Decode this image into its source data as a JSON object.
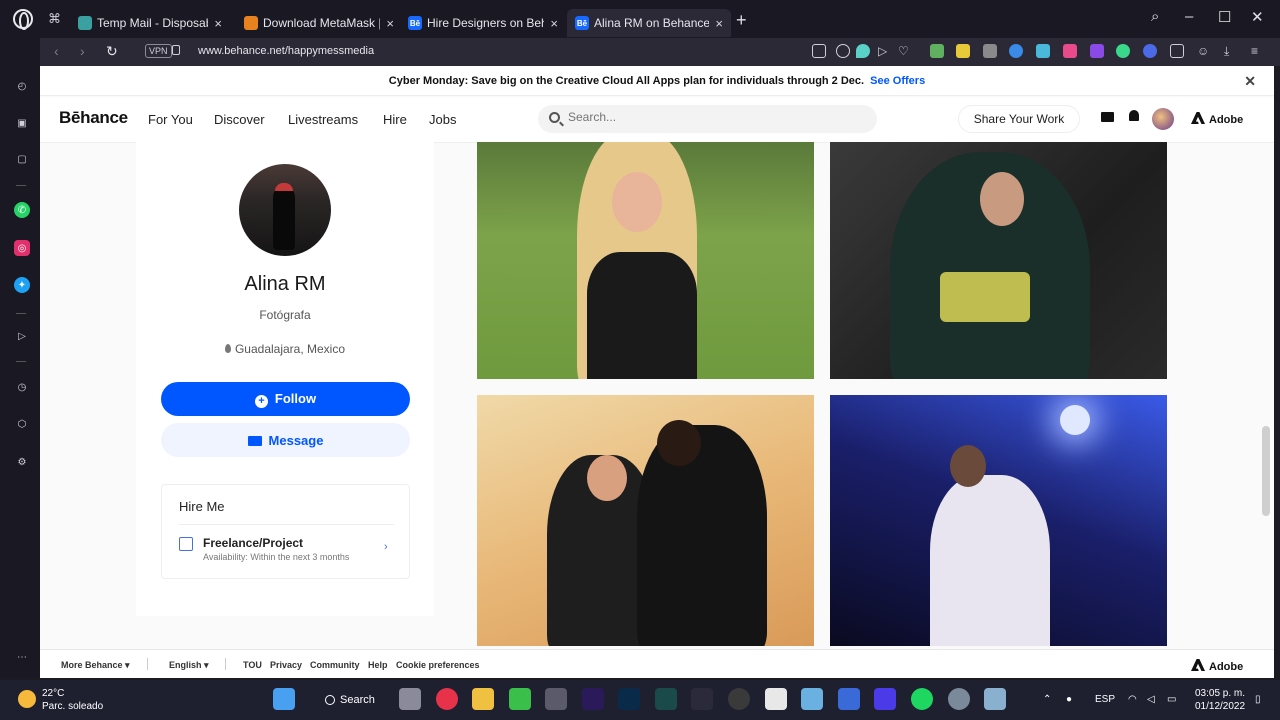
{
  "browser": {
    "tabs": [
      {
        "title": "Temp Mail - Disposable Ter",
        "color": "#3aa0a0",
        "fav": ""
      },
      {
        "title": "Download MetaMask | Bloc",
        "color": "#e8821e",
        "fav": ""
      },
      {
        "title": "Hire Designers on Behance",
        "color": "#1769ff",
        "fav": "Bē"
      },
      {
        "title": "Alina RM on Behance",
        "color": "#1769ff",
        "fav": "Bē"
      }
    ],
    "url": "www.behance.net/happymessmedia",
    "vpn": "VPN"
  },
  "promo": {
    "text": "Cyber Monday: Save big on the Creative Cloud All Apps plan for individuals through 2 Dec.",
    "link": "See Offers"
  },
  "nav": {
    "logo": "Bēhance",
    "links": [
      "For You",
      "Discover",
      "Livestreams",
      "Hire",
      "Jobs"
    ],
    "search_placeholder": "Search...",
    "share": "Share Your Work",
    "adobe": "Adobe"
  },
  "profile": {
    "name": "Alina RM",
    "role": "Fotógrafa",
    "location": "Guadalajara, Mexico",
    "follow": "Follow",
    "message": "Message",
    "hire_title": "Hire Me",
    "hire_item": "Freelance/Project",
    "hire_sub": "Availability: Within the next 3 months"
  },
  "footer": {
    "more": "More Behance ▾",
    "lang": "English ▾",
    "links": [
      "TOU",
      "Privacy",
      "Community",
      "Help",
      "Cookie preferences"
    ],
    "adobe": "Adobe"
  },
  "taskbar": {
    "temp": "22°C",
    "weather": "Parc. soleado",
    "search": "Search",
    "lang": "ESP",
    "time": "03:05 p. m.",
    "date": "01/12/2022"
  }
}
